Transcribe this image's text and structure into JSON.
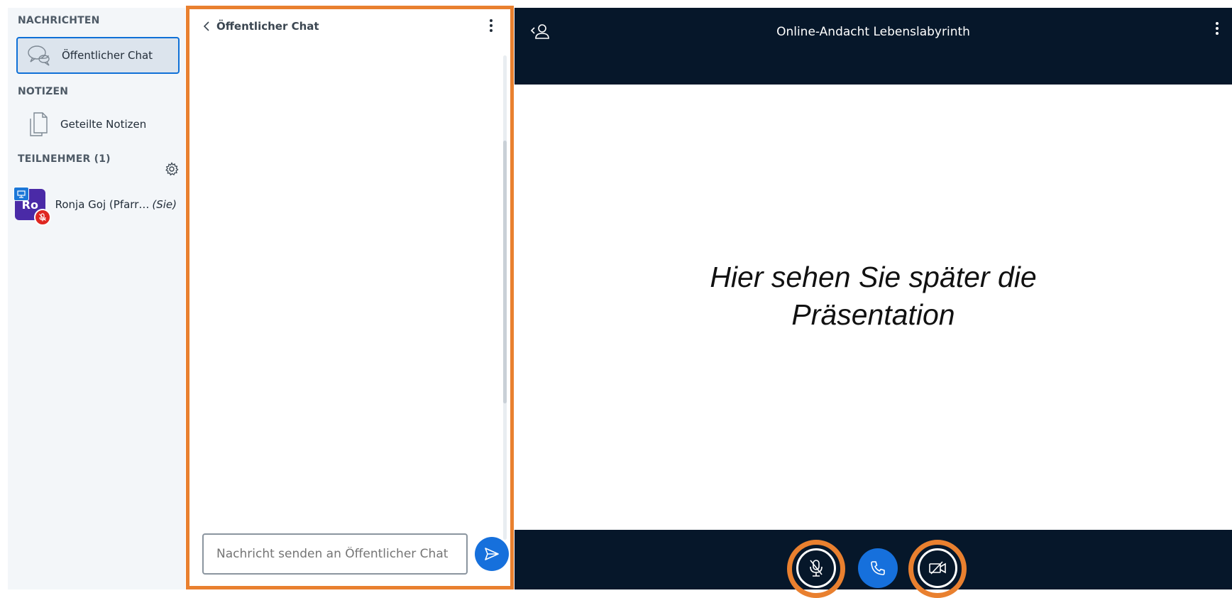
{
  "sidebar": {
    "messages_title": "NACHRICHTEN",
    "public_chat_label": "Öffentlicher Chat",
    "notes_title": "NOTIZEN",
    "shared_notes_label": "Geteilte Notizen",
    "participants_title": "TEILNEHMER (1)",
    "user": {
      "initials": "Ro",
      "name": "Ronja Goj (Pfarr…",
      "you_label": "(Sie)"
    }
  },
  "chat": {
    "title": "Öffentlicher Chat",
    "input_placeholder": "Nachricht senden an Öffentlicher Chat"
  },
  "header": {
    "meeting_title": "Online-Andacht Lebenslabyrinth"
  },
  "presentation": {
    "line1": "Hier sehen Sie später die",
    "line2": "Präsentation"
  },
  "colors": {
    "highlight": "#e9802f",
    "navy": "#06172a",
    "primary": "#1670dc",
    "avatar": "#4a2aa7",
    "muted_badge": "#df2721"
  },
  "icons": {
    "public_chat": "chat-bubbles-icon",
    "shared_notes": "notes-icon",
    "settings": "gear-icon",
    "back": "chevron-left-icon",
    "send": "send-icon",
    "user_list": "user-list-toggle-icon",
    "mic": "microphone-muted-icon",
    "phone": "phone-icon",
    "camera": "camera-off-icon"
  }
}
